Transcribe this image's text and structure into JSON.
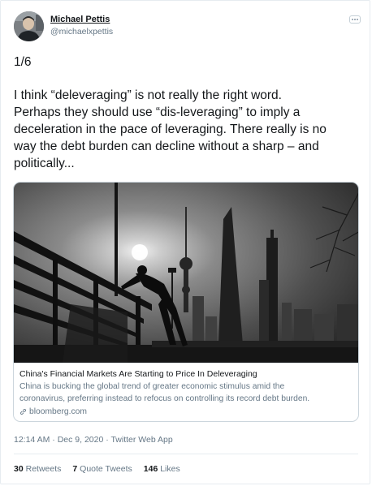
{
  "author": {
    "name": "Michael Pettis",
    "handle": "@michaelxpettis"
  },
  "tweet": {
    "counter": "1/6",
    "body_lines": [
      "I think “deleveraging” is not really the right word.",
      "Perhaps they should use “dis-leveraging” to imply a",
      "deceleration in the pace of leveraging. There really is no",
      "way the debt burden can decline without a sharp – and",
      "politically..."
    ]
  },
  "card": {
    "title": "China's Financial Markets Are Starting to Price In Deleveraging",
    "description_lines": [
      "China is bucking the global trend of greater economic stimulus amid the",
      "coronavirus, preferring instead to refocus on controlling its record debt burden."
    ],
    "domain": "bloomberg.com"
  },
  "meta": {
    "timestamp": "12:14 AM · Dec 9, 2020 · Twitter Web App"
  },
  "stats": {
    "retweets_count": "30",
    "retweets_label": "Retweets",
    "quote_count": "7",
    "quote_label": "Quote Tweets",
    "likes_count": "146",
    "likes_label": "Likes"
  },
  "icons": {
    "more": "more-options-icon",
    "link": "link-icon"
  }
}
